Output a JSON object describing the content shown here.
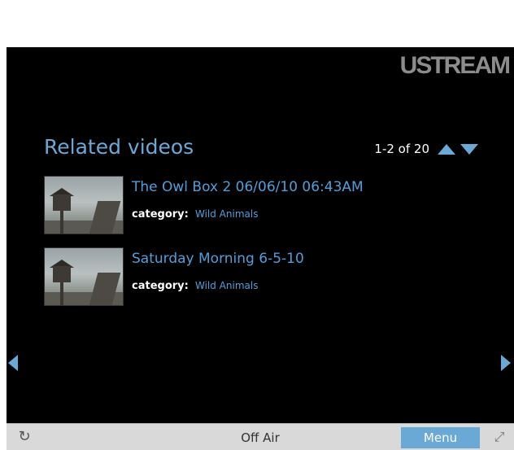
{
  "brand": {
    "logo_text": "USTREAM"
  },
  "related": {
    "title": "Related videos",
    "pager": {
      "text": "1-2 of 20",
      "up_icon": "triangle-up-icon",
      "down_icon": "triangle-down-icon"
    },
    "items": [
      {
        "title": "The Owl Box 2 06/06/10 06:43AM",
        "category_label": "category:",
        "category": "Wild Animals"
      },
      {
        "title": "Saturday Morning 6-5-10",
        "category_label": "category:",
        "category": "Wild Animals"
      }
    ]
  },
  "navigation": {
    "prev_icon": "arrow-left-icon",
    "next_icon": "arrow-right-icon"
  },
  "bottombar": {
    "refresh_icon": "refresh-icon",
    "status": "Off Air",
    "menu_label": "Menu",
    "fullscreen_icon": "fullscreen-icon"
  },
  "colors": {
    "accent": "#6aa9d6",
    "link": "#4f9fdc",
    "background": "#000000",
    "bar": "#d9d9d9"
  }
}
